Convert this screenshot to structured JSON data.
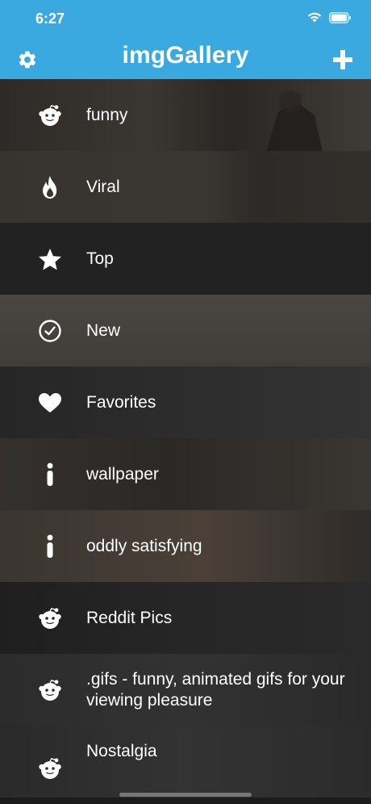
{
  "status": {
    "time": "6:27"
  },
  "header": {
    "title": "imgGallery",
    "settings_icon": "gear-icon",
    "add_icon": "plus-icon"
  },
  "colors": {
    "header": "#3aa9df",
    "text": "#ffffff"
  },
  "menu": {
    "items": [
      {
        "label": "funny",
        "icon": "reddit-icon"
      },
      {
        "label": "Viral",
        "icon": "flame-icon"
      },
      {
        "label": "Top",
        "icon": "star-icon"
      },
      {
        "label": "New",
        "icon": "clock-check-icon"
      },
      {
        "label": "Favorites",
        "icon": "heart-icon"
      },
      {
        "label": "wallpaper",
        "icon": "info-icon"
      },
      {
        "label": "oddly satisfying",
        "icon": "info-icon"
      },
      {
        "label": "Reddit Pics",
        "icon": "reddit-icon"
      },
      {
        "label": ".gifs - funny, animated gifs for your viewing pleasure",
        "icon": "reddit-icon"
      },
      {
        "label": "Nostalgia",
        "icon": "reddit-icon"
      }
    ]
  }
}
